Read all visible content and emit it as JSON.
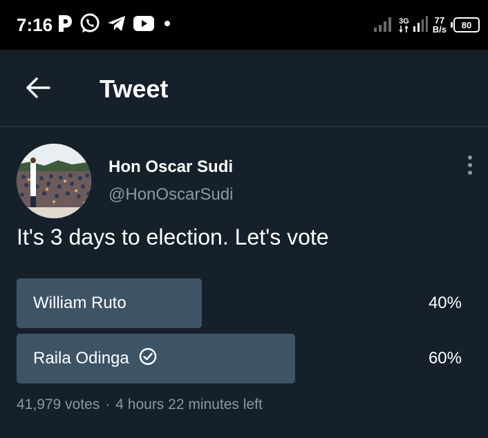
{
  "status_bar": {
    "time": "7:16",
    "network_type": "3G",
    "net_speed_value": "77",
    "net_speed_unit": "B/s",
    "battery_level": "80",
    "notification_icons": [
      "parking-app-icon",
      "whatsapp-icon",
      "telegram-icon",
      "youtube-icon",
      "more-notifications-dot-icon"
    ]
  },
  "header": {
    "title": "Tweet",
    "back_icon": "arrow-left-icon"
  },
  "tweet": {
    "author_name": "Hon Oscar Sudi",
    "author_handle": "@HonOscarSudi",
    "text": "It's 3 days to election. Let's vote",
    "more_icon": "vertical-ellipsis-icon"
  },
  "poll": {
    "options": [
      {
        "label": "William Ruto",
        "percent_label": "40%",
        "percent": 40,
        "selected": false
      },
      {
        "label": "Raila Odinga",
        "percent_label": "60%",
        "percent": 60,
        "selected": true
      }
    ],
    "votes": "41,979 votes",
    "separator": "·",
    "time_left": "4 hours 22 minutes left"
  },
  "colors": {
    "background": "#15202b",
    "status_bar": "#000000",
    "poll_fill": "#3d5466",
    "secondary_text": "#8b98a5",
    "divider": "#38444d"
  }
}
